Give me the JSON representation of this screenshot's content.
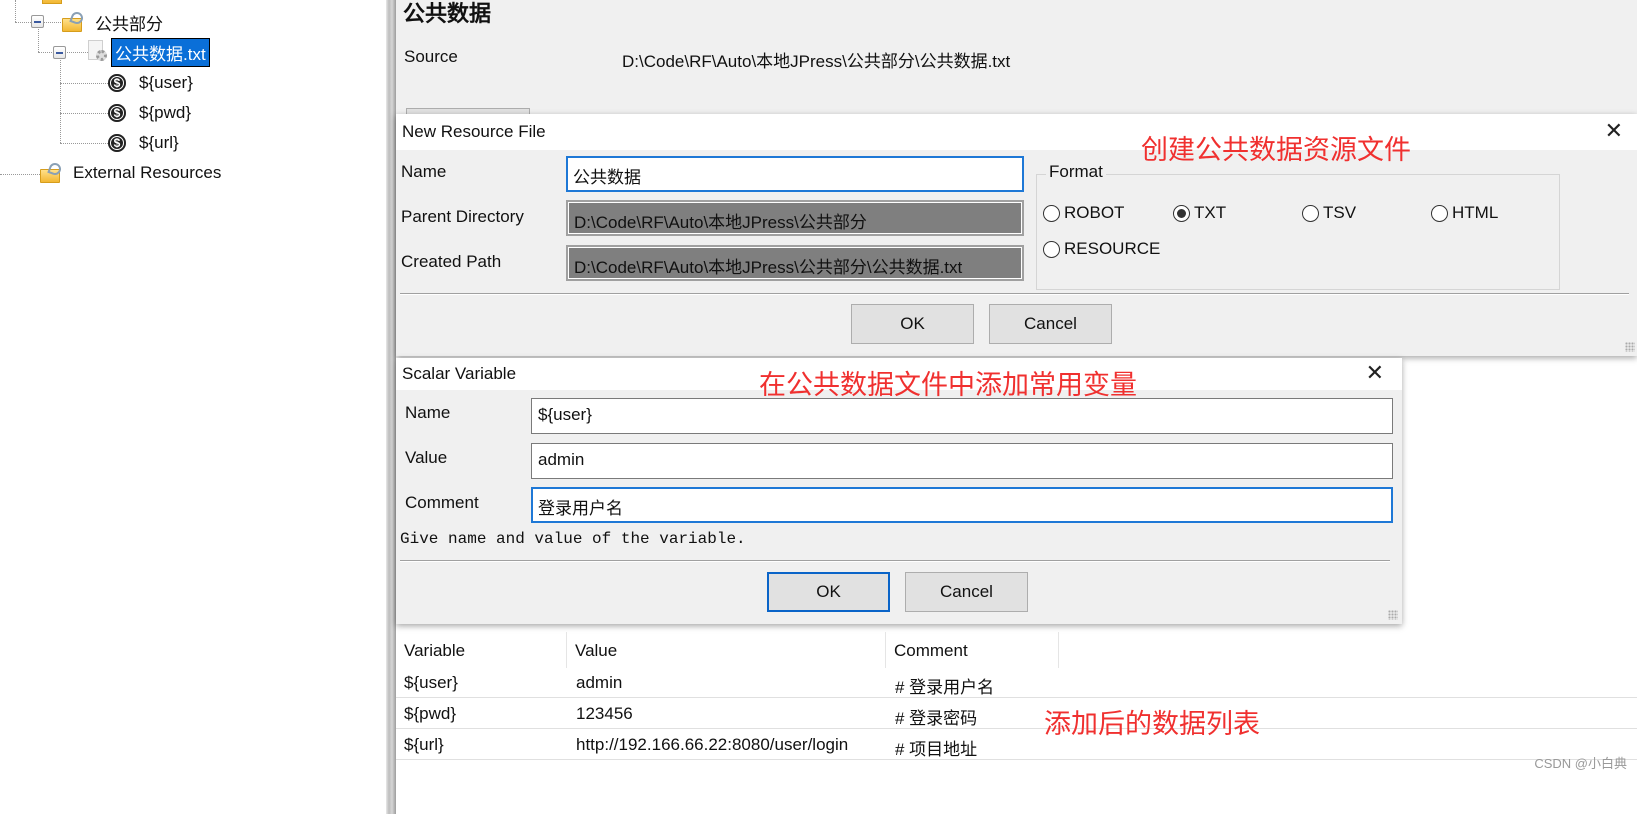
{
  "tree": {
    "items": [
      {
        "label": "公共部分",
        "icon": "resource-folder-icon"
      },
      {
        "label": "公共数据.txt",
        "icon": "resource-file-icon",
        "selected": true
      },
      {
        "label": "${user}",
        "icon": "scalar-variable-icon"
      },
      {
        "label": "${pwd}",
        "icon": "scalar-variable-icon"
      },
      {
        "label": "${url}",
        "icon": "scalar-variable-icon"
      },
      {
        "label": "External Resources",
        "icon": "resource-folder-icon"
      }
    ]
  },
  "editor": {
    "title": "公共数据",
    "source_label": "Source",
    "source_value": "D:\\Code\\RF\\Auto\\本地JPress\\公共部分\\公共数据.txt"
  },
  "new_resource_dialog": {
    "title": "New Resource File",
    "annotation": "创建公共数据资源文件",
    "annotation_color": "#f0302f",
    "name_label": "Name",
    "name_value": "公共数据",
    "parent_dir_label": "Parent Directory",
    "parent_dir_value": "D:\\Code\\RF\\Auto\\本地JPress\\公共部分",
    "created_path_label": "Created Path",
    "created_path_value": "D:\\Code\\RF\\Auto\\本地JPress\\公共部分\\公共数据.txt",
    "format_label": "Format",
    "formats": [
      {
        "label": "ROBOT",
        "checked": false
      },
      {
        "label": "TXT",
        "checked": true
      },
      {
        "label": "TSV",
        "checked": false
      },
      {
        "label": "HTML",
        "checked": false
      },
      {
        "label": "RESOURCE",
        "checked": false
      }
    ],
    "ok_label": "OK",
    "cancel_label": "Cancel"
  },
  "scalar_dialog": {
    "title": "Scalar Variable",
    "annotation": "在公共数据文件中添加常用变量",
    "name_label": "Name",
    "name_value": "${user}",
    "value_label": "Value",
    "value_value": "admin",
    "comment_label": "Comment",
    "comment_value": "登录用户名",
    "hint": "Give name and value of the variable.",
    "ok_label": "OK",
    "cancel_label": "Cancel"
  },
  "variables_table": {
    "columns": [
      "Variable",
      "Value",
      "Comment"
    ],
    "rows": [
      {
        "variable": "${user}",
        "value": "admin",
        "comment": "# 登录用户名"
      },
      {
        "variable": "${pwd}",
        "value": "123456",
        "comment": "# 登录密码"
      },
      {
        "variable": "${url}",
        "value": "http://192.166.66.22:8080/user/login",
        "comment": "# 项目地址"
      }
    ],
    "annotation": "添加后的数据列表"
  },
  "watermark": "CSDN @小白典"
}
